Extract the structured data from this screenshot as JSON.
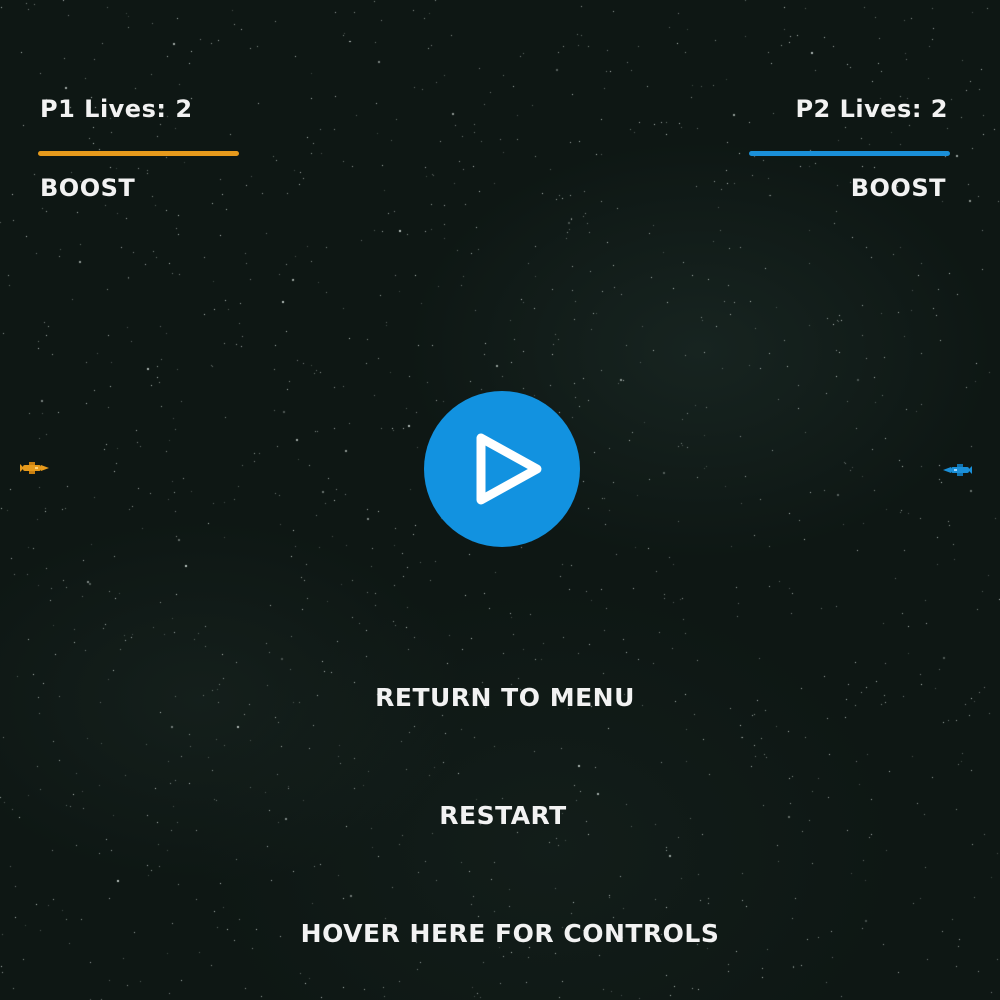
{
  "hud": {
    "p1": {
      "lives_label": "P1 Lives: 2",
      "boost_label": "BOOST",
      "boost_level": 1.0,
      "color": "#e69a1c"
    },
    "p2": {
      "lives_label": "P2 Lives: 2",
      "boost_label": "BOOST",
      "boost_level": 1.0,
      "color": "#1a8fd8"
    }
  },
  "play_button": {
    "icon": "play-icon",
    "color": "#1292e0"
  },
  "menu": {
    "return_label": "RETURN TO MENU",
    "restart_label": "RESTART",
    "controls_label": "HOVER HERE FOR CONTROLS"
  },
  "ships": {
    "p1_icon": "orange-ship-icon",
    "p2_icon": "blue-ship-icon"
  }
}
